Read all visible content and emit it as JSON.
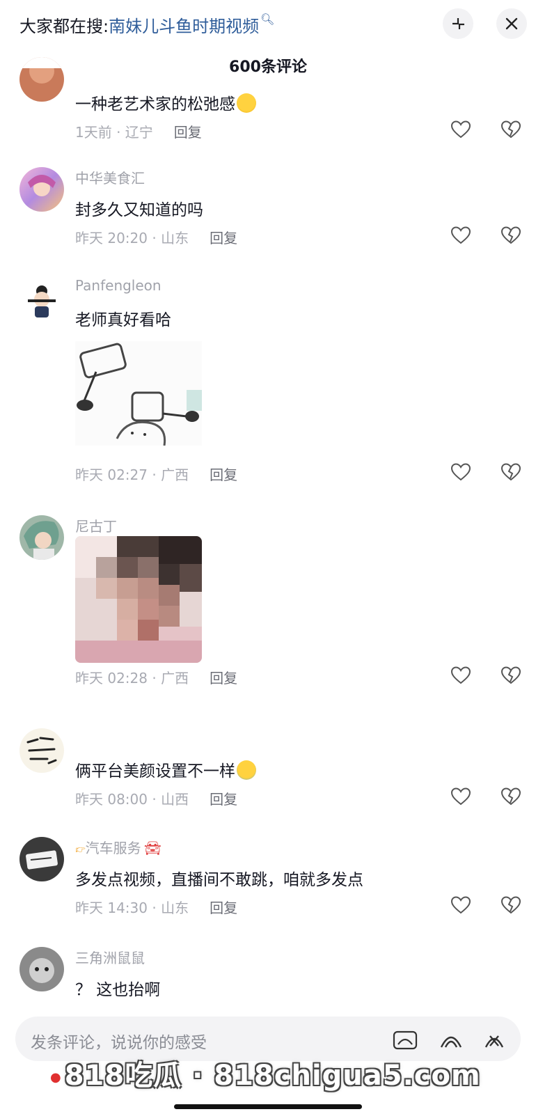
{
  "header": {
    "search_prefix": "大家都在搜:",
    "search_keyword": "南妹儿斗鱼时期视频",
    "comment_count": "600条评论"
  },
  "comments": [
    {
      "username": "",
      "text": "一种老艺术家的松弛感",
      "time": "1天前 · 辽宁",
      "reply": "回复"
    },
    {
      "username": "中华美食汇",
      "text": "封多久又知道的吗",
      "time": "昨天 20:20 · 山东",
      "reply": "回复"
    },
    {
      "username": "Panfengleon",
      "text": "老师真好看哈",
      "time": "昨天 02:27 · 广西",
      "reply": "回复"
    },
    {
      "username": "尼古丁",
      "text": "",
      "time": "昨天 02:28 · 广西",
      "reply": "回复"
    },
    {
      "username": "",
      "text": "俩平台美颜设置不一样",
      "time": "昨天 08:00 · 山西",
      "reply": "回复"
    },
    {
      "username": "汽车服务",
      "text": "多发点视频，直播间不敢跳，咱就多发点",
      "time": "昨天 14:30 · 山东",
      "reply": "回复"
    },
    {
      "username": "三角洲鼠鼠",
      "text": "？ 这也抬啊",
      "time": "",
      "reply": ""
    }
  ],
  "input": {
    "placeholder": "发条评论，说说你的感受"
  },
  "watermark": "818吃瓜 · 818chigua5.com",
  "colors": {
    "keyword": "#2f5d9a",
    "muted": "#a8aab2",
    "text": "#161823"
  },
  "icons": [
    "collapse-icon",
    "close-icon",
    "like-icon",
    "dislike-icon",
    "emoji-icon",
    "gif-icon",
    "at-icon"
  ]
}
